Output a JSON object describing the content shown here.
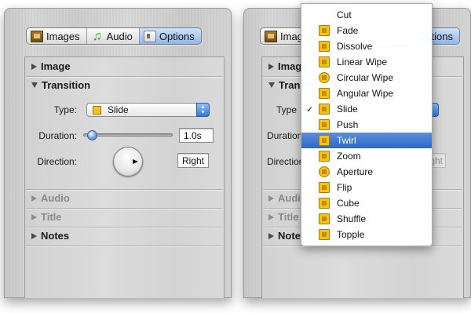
{
  "tabs": [
    {
      "label": "Images",
      "icon": "images-icon"
    },
    {
      "label": "Audio",
      "icon": "audio-note-icon"
    },
    {
      "label": "Options",
      "icon": "options-icon"
    }
  ],
  "sections": {
    "image": "Image",
    "transition": "Transition",
    "audio": "Audio",
    "title": "Title",
    "notes": "Notes"
  },
  "transition": {
    "type_label": "Type:",
    "type_value": "Slide",
    "duration_label": "Duration:",
    "duration_value": "1.0s",
    "duration_level": 0.05,
    "direction_label": "Direction:",
    "direction_value": "Right"
  },
  "right_panel": {
    "tab_images": "Images",
    "tab_options": "Options",
    "section_image": "Image",
    "section_transition": "Transition",
    "type_label": "Type",
    "duration_label": "Duration",
    "direction_label": "Direction",
    "direction_value": "Right",
    "section_audio": "Audio",
    "section_title": "Title",
    "section_notes": "Notes"
  },
  "menu": {
    "items": [
      {
        "label": "Cut",
        "icon": "none",
        "checked": false,
        "selected": false
      },
      {
        "label": "Fade",
        "icon": "fade-icon",
        "checked": false,
        "selected": false
      },
      {
        "label": "Dissolve",
        "icon": "dissolve-icon",
        "checked": false,
        "selected": false
      },
      {
        "label": "Linear Wipe",
        "icon": "linear-wipe-icon",
        "checked": false,
        "selected": false
      },
      {
        "label": "Circular Wipe",
        "icon": "circular-wipe-icon",
        "checked": false,
        "selected": false
      },
      {
        "label": "Angular Wipe",
        "icon": "angular-wipe-icon",
        "checked": false,
        "selected": false
      },
      {
        "label": "Slide",
        "icon": "slide-icon",
        "checked": true,
        "selected": false
      },
      {
        "label": "Push",
        "icon": "push-icon",
        "checked": false,
        "selected": false
      },
      {
        "label": "Twirl",
        "icon": "twirl-icon",
        "checked": false,
        "selected": true
      },
      {
        "label": "Zoom",
        "icon": "zoom-icon",
        "checked": false,
        "selected": false
      },
      {
        "label": "Aperture",
        "icon": "aperture-icon",
        "checked": false,
        "selected": false
      },
      {
        "label": "Flip",
        "icon": "flip-icon",
        "checked": false,
        "selected": false
      },
      {
        "label": "Cube",
        "icon": "cube-icon",
        "checked": false,
        "selected": false
      },
      {
        "label": "Shuffle",
        "icon": "shuffle-icon",
        "checked": false,
        "selected": false
      },
      {
        "label": "Topple",
        "icon": "topple-icon",
        "checked": false,
        "selected": false
      }
    ],
    "check_glyph": "✓"
  },
  "colors": {
    "selection": "#2f67c7",
    "tab_selected": "#8fb6ea",
    "transition_icon": "#f3c21c"
  }
}
